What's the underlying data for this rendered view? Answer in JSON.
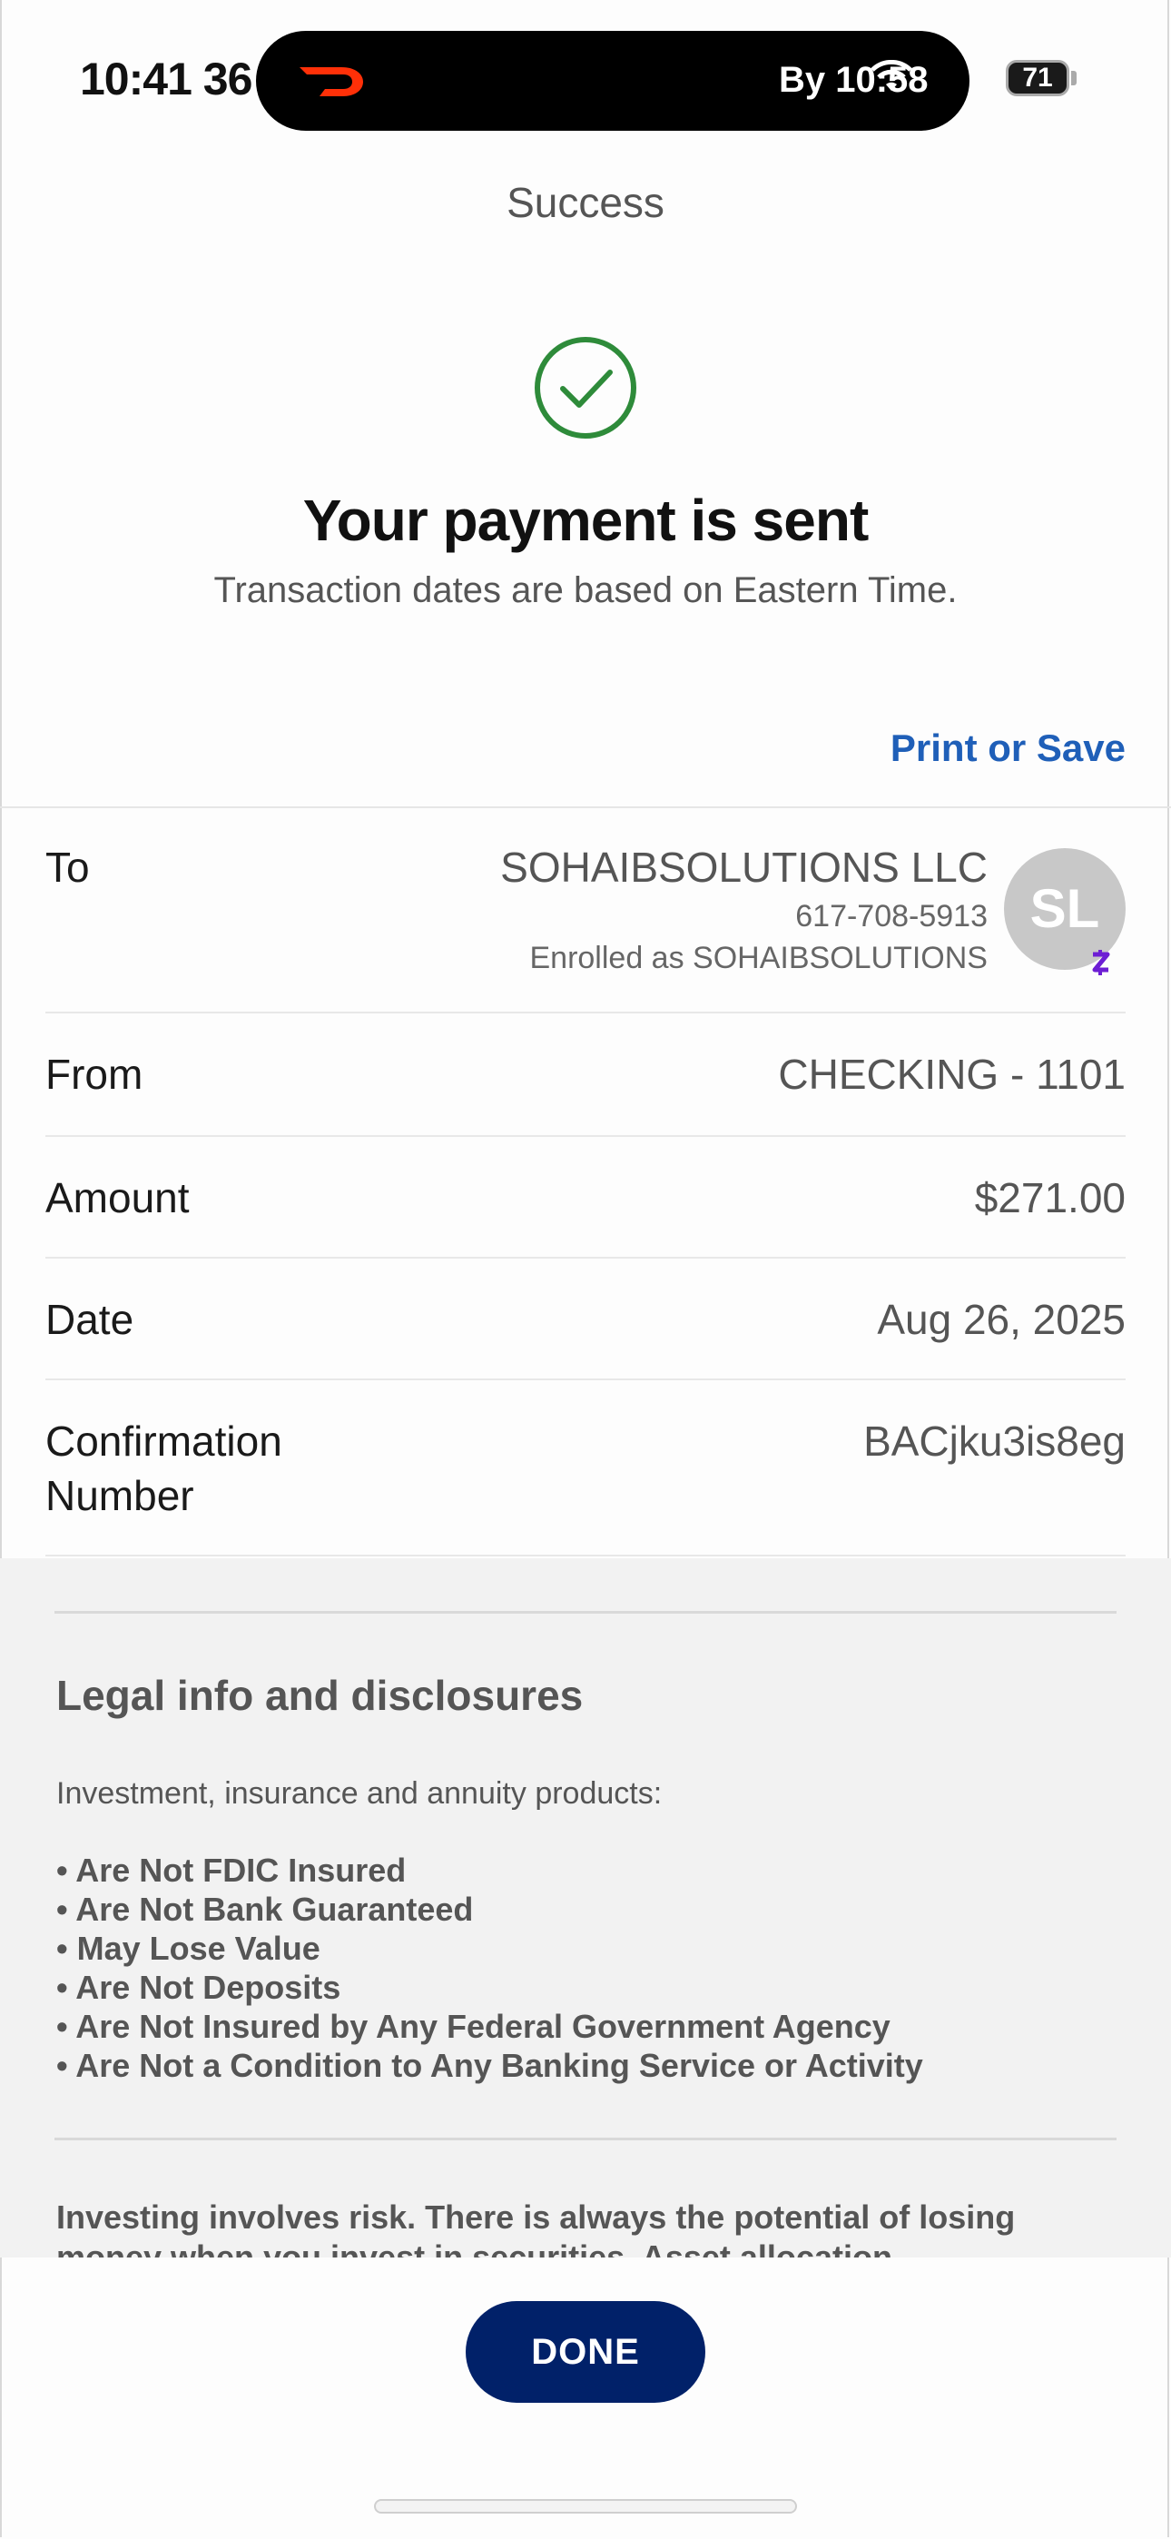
{
  "status_bar": {
    "time": "10:41 36",
    "island_text": "By 10:58",
    "battery": "71"
  },
  "header": {
    "title": "Success"
  },
  "confirmation": {
    "headline": "Your payment is sent",
    "subline": "Transaction dates are based on Eastern Time.",
    "print_label": "Print or Save"
  },
  "details": {
    "to": {
      "label": "To",
      "name": "SOHAIBSOLUTIONS LLC",
      "phone": "617-708-5913",
      "enrolled": "Enrolled as SOHAIBSOLUTIONS",
      "avatar_initials": "SL"
    },
    "from": {
      "label": "From",
      "value": "CHECKING - 1101"
    },
    "amount": {
      "label": "Amount",
      "value": "$271.00"
    },
    "date": {
      "label": "Date",
      "value": "Aug 26, 2025"
    },
    "confirmation_number": {
      "label_line1": "Confirmation",
      "label_line2": "Number",
      "value": "BACjku3is8eg"
    }
  },
  "legal": {
    "title": "Legal info and disclosures",
    "intro": "Investment, insurance and annuity products:",
    "items": [
      "• Are Not FDIC Insured",
      "• Are Not Bank Guaranteed",
      "• May Lose Value",
      "• Are Not Deposits",
      "• Are Not Insured by Any Federal Government Agency",
      "• Are Not a Condition to Any Banking Service or Activity"
    ],
    "paragraph": "Investing involves risk. There is always the potential of losing money when you invest in securities. Asset allocation"
  },
  "footer": {
    "done_label": "DONE"
  },
  "colors": {
    "accent_link": "#1f5fb8",
    "done_button": "#012169",
    "success_green": "#2e8b3a",
    "zelle_purple": "#6d1ed4"
  },
  "icons": {
    "app_icon": "doordash-icon",
    "success": "checkmark-circle-icon",
    "zelle": "zelle-badge-icon",
    "wifi": "wifi-icon"
  }
}
